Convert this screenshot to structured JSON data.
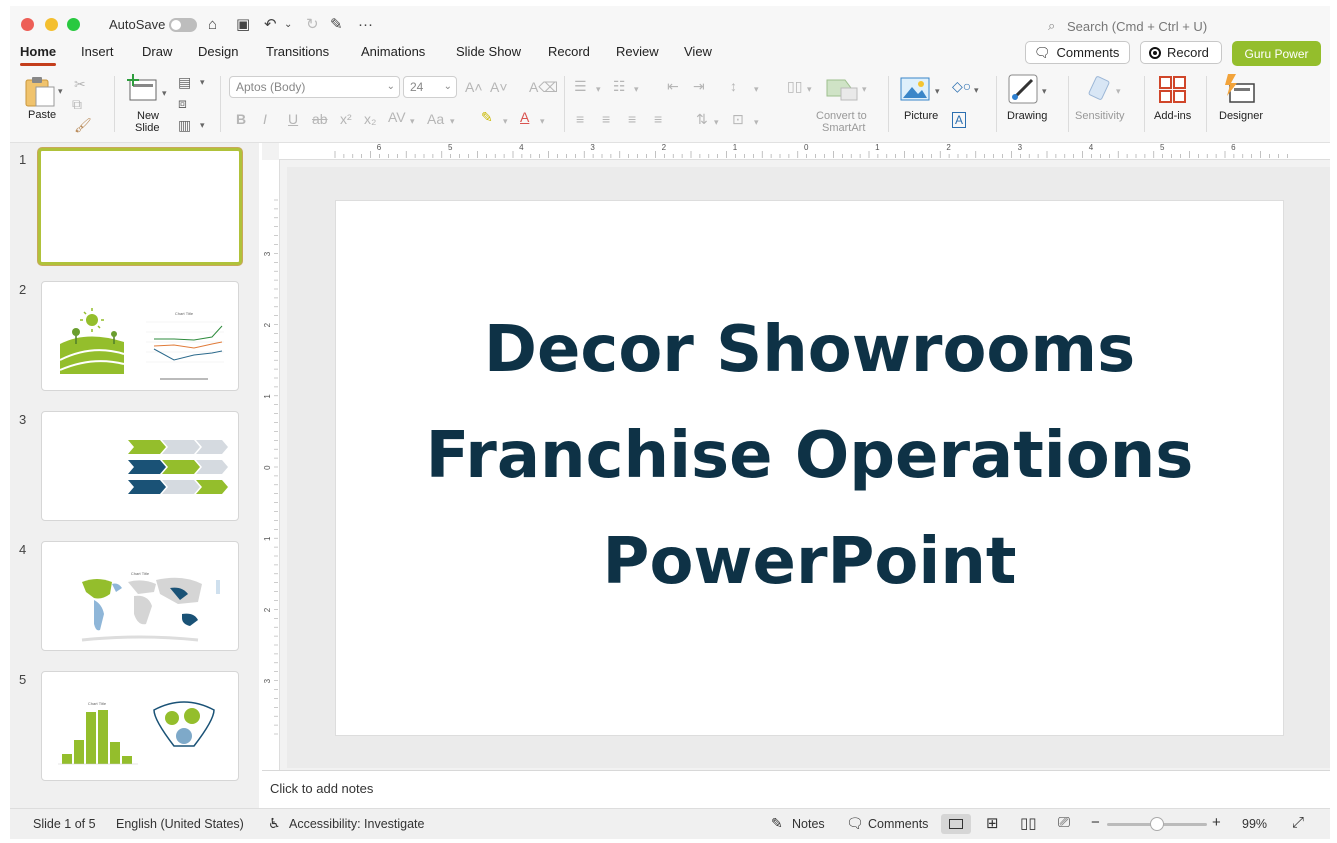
{
  "titlebar": {
    "autosave_label": "AutoSave",
    "search_placeholder": "Search (Cmd + Ctrl + U)"
  },
  "tabs": [
    "Home",
    "Insert",
    "Draw",
    "Design",
    "Transitions",
    "Animations",
    "Slide Show",
    "Record",
    "Review",
    "View"
  ],
  "actions": {
    "comments": "Comments",
    "record": "Record",
    "guru": "Guru Power"
  },
  "ribbon": {
    "paste": "Paste",
    "new_slide_1": "New",
    "new_slide_2": "Slide",
    "font_name": "Aptos (Body)",
    "font_size": "24",
    "convert_1": "Convert to",
    "convert_2": "SmartArt",
    "picture": "Picture",
    "drawing": "Drawing",
    "sensitivity": "Sensitivity",
    "addins": "Add-ins",
    "designer": "Designer"
  },
  "slides": [
    {
      "number": "1"
    },
    {
      "number": "2"
    },
    {
      "number": "3"
    },
    {
      "number": "4"
    },
    {
      "number": "5"
    }
  ],
  "thumbs": {
    "chart_title": "Chart Title"
  },
  "ruler": {
    "h_ticks": [
      "6",
      "5",
      "4",
      "3",
      "2",
      "1",
      "0",
      "1",
      "2",
      "3",
      "4",
      "5",
      "6"
    ],
    "v_ticks": [
      "3",
      "2",
      "1",
      "0",
      "1",
      "2",
      "3"
    ]
  },
  "slide": {
    "title_line1": "Decor Showrooms",
    "title_line2": "Franchise Operations",
    "title_line3": "PowerPoint"
  },
  "notes": {
    "placeholder": "Click to add notes"
  },
  "status": {
    "slide_position": "Slide 1 of 5",
    "language": "English (United States)",
    "accessibility": "Accessibility: Investigate",
    "notes": "Notes",
    "comments": "Comments",
    "zoom": "99%",
    "zoom_fraction": 0.5
  },
  "colors": {
    "accent_tab": "#c43e1c",
    "title_text": "#0e3246",
    "guru": "#94be2c",
    "thumb_green": "#94be2c",
    "thumb_navy": "#1a5276"
  }
}
